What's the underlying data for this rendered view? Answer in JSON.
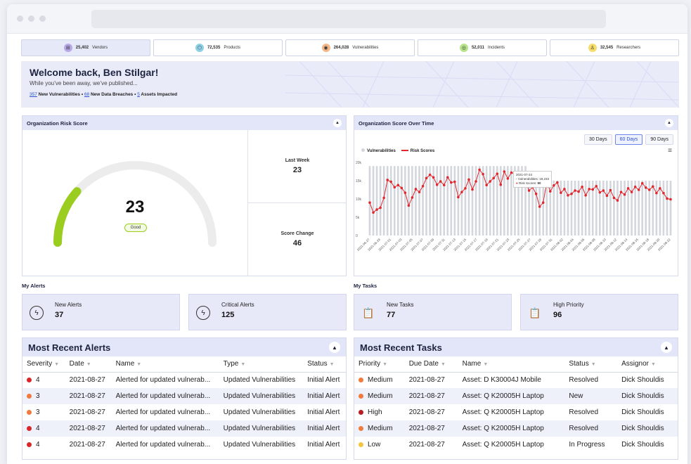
{
  "stats": [
    {
      "value": "25,402",
      "label": "Vendors",
      "color": "#b9a8e8",
      "icon": "vendors-icon",
      "glyph": "⊞"
    },
    {
      "value": "72,535",
      "label": "Products",
      "color": "#8fd0e6",
      "icon": "products-icon",
      "glyph": "⬡"
    },
    {
      "value": "264,028",
      "label": "Vulnerabilities",
      "color": "#f3b98a",
      "icon": "vulnerabilities-icon",
      "glyph": "◉"
    },
    {
      "value": "52,011",
      "label": "Incidents",
      "color": "#b8e58c",
      "icon": "incidents-icon",
      "glyph": "◎"
    },
    {
      "value": "32,545",
      "label": "Researchers",
      "color": "#f6dc6b",
      "icon": "researchers-icon",
      "glyph": "♙"
    }
  ],
  "hero": {
    "title": "Welcome back, Ben Stilgar!",
    "subtitle": "While you’ve been away, we’ve published...",
    "new_vulns_count": "357",
    "new_vulns_text": " New Vulnerabilities • ",
    "breaches_count": "68",
    "breaches_text": " New Data Breaches • ",
    "assets_count": "5",
    "assets_text": " Assets Impacted"
  },
  "risk": {
    "title": "Organization Risk Score",
    "score": "23",
    "score_fraction": 0.23,
    "badge": "Good",
    "last_week_label": "Last Week",
    "last_week_value": "23",
    "change_label": "Score Change",
    "change_value": "46",
    "gauge_color": "#9acd1f"
  },
  "time_panel": {
    "title": "Organization Score Over Time",
    "ranges": [
      "30 Days",
      "60 Days",
      "90 Days"
    ],
    "selected_range": "60 Days",
    "tooltip_date": "2021-07-24",
    "tooltip_vuln": "Vulnerabilities: 19,233",
    "tooltip_risk_label": "Risk Scores:",
    "tooltip_risk_value": "90"
  },
  "chart_data": {
    "type": "line",
    "series": [
      {
        "name": "Vulnerabilities",
        "type": "bar",
        "color": "#d4d6de"
      },
      {
        "name": "Risk Scores",
        "type": "line",
        "color": "#e0282e",
        "values": [
          9000,
          6300,
          7100,
          7600,
          10300,
          15200,
          14700,
          13200,
          13800,
          13000,
          11700,
          8200,
          10400,
          12700,
          11900,
          13500,
          15700,
          16600,
          15900,
          13900,
          14800,
          13800,
          15900,
          14500,
          14700,
          10500,
          11900,
          12900,
          15300,
          12600,
          14800,
          18000,
          16800,
          13800,
          14800,
          15700,
          16900,
          13900,
          17500,
          15600,
          17200,
          16900,
          17200,
          13500,
          14600,
          12300,
          13200,
          11400,
          7900,
          9000,
          14600,
          12100,
          13700,
          14500,
          11700,
          12700,
          11000,
          11400,
          12300,
          12000,
          13300,
          11000,
          12700,
          12600,
          13500,
          11800,
          12300,
          10900,
          12400,
          10300,
          9600,
          11900,
          11200,
          12900,
          11900,
          13300,
          12500,
          14300,
          13100,
          12500,
          13400,
          11600,
          12900,
          11600,
          10100,
          9900
        ]
      }
    ],
    "ylabel_ticks": [
      "0",
      "5k",
      "10k",
      "15k",
      "20k"
    ],
    "ylim": [
      0,
      20000
    ],
    "x_tick_labels": [
      "2021-06-27",
      "2021-06-29",
      "2021-07-01",
      "2021-07-03",
      "2021-07-05",
      "2021-07-07",
      "2021-07-09",
      "2021-07-11",
      "2021-07-13",
      "2021-07-15",
      "2021-07-17",
      "2021-07-19",
      "2021-07-21",
      "2021-07-23",
      "2021-07-25",
      "2021-07-27",
      "2021-07-29",
      "2021-07-31",
      "2021-08-02",
      "2021-08-04",
      "2021-08-06",
      "2021-08-08",
      "2021-08-10",
      "2021-08-12",
      "2021-08-14",
      "2021-08-16",
      "2021-08-18",
      "2021-08-20",
      "2021-08-22"
    ],
    "legend": "top-left",
    "grid": false
  },
  "my_alerts": {
    "label": "My Alerts",
    "cards": [
      {
        "label": "New Alerts",
        "value": "37"
      },
      {
        "label": "Critical Alerts",
        "value": "125"
      }
    ]
  },
  "my_tasks": {
    "label": "My Tasks",
    "cards": [
      {
        "label": "New Tasks",
        "value": "77"
      },
      {
        "label": "High Priority",
        "value": "96"
      }
    ]
  },
  "alerts_table": {
    "title": "Most Recent Alerts",
    "columns": [
      "Severity",
      "Date",
      "Name",
      "Type",
      "Status"
    ],
    "rows": [
      {
        "color": "#d9262b",
        "severity": "4",
        "date": "2021-08-27",
        "name": "Alerted for updated vulnerab...",
        "type": "Updated Vulnerabilities",
        "status": "Initial Alert"
      },
      {
        "color": "#f07b3c",
        "severity": "3",
        "date": "2021-08-27",
        "name": "Alerted for updated vulnerab...",
        "type": "Updated Vulnerabilities",
        "status": "Initial Alert"
      },
      {
        "color": "#f07b3c",
        "severity": "3",
        "date": "2021-08-27",
        "name": "Alerted for updated vulnerab...",
        "type": "Updated Vulnerabilities",
        "status": "Initial Alert"
      },
      {
        "color": "#d9262b",
        "severity": "4",
        "date": "2021-08-27",
        "name": "Alerted for updated vulnerab...",
        "type": "Updated Vulnerabilities",
        "status": "Initial Alert"
      },
      {
        "color": "#d9262b",
        "severity": "4",
        "date": "2021-08-27",
        "name": "Alerted for updated vulnerab...",
        "type": "Updated Vulnerabilities",
        "status": "Initial Alert"
      }
    ]
  },
  "tasks_table": {
    "title": "Most Recent Tasks",
    "columns": [
      "Priority",
      "Due Date",
      "Name",
      "Status",
      "Assignor"
    ],
    "rows": [
      {
        "color": "#f07b3c",
        "priority": "Medium",
        "date": "2021-08-27",
        "name": "Asset: D K30004J Mobile",
        "status": "Resolved",
        "assignor": "Dick Shouldis"
      },
      {
        "color": "#f07b3c",
        "priority": "Medium",
        "date": "2021-08-27",
        "name": "Asset: Q K20005H Laptop",
        "status": "New",
        "assignor": "Dick Shouldis"
      },
      {
        "color": "#b81d24",
        "priority": "High",
        "date": "2021-08-27",
        "name": "Asset: Q K20005H Laptop",
        "status": "Resolved",
        "assignor": "Dick Shouldis"
      },
      {
        "color": "#f07b3c",
        "priority": "Medium",
        "date": "2021-08-27",
        "name": "Asset: Q K20005H Laptop",
        "status": "Resolved",
        "assignor": "Dick Shouldis"
      },
      {
        "color": "#f5c542",
        "priority": "Low",
        "date": "2021-08-27",
        "name": "Asset: Q K20005H Laptop",
        "status": "In Progress",
        "assignor": "Dick Shouldis"
      }
    ]
  }
}
